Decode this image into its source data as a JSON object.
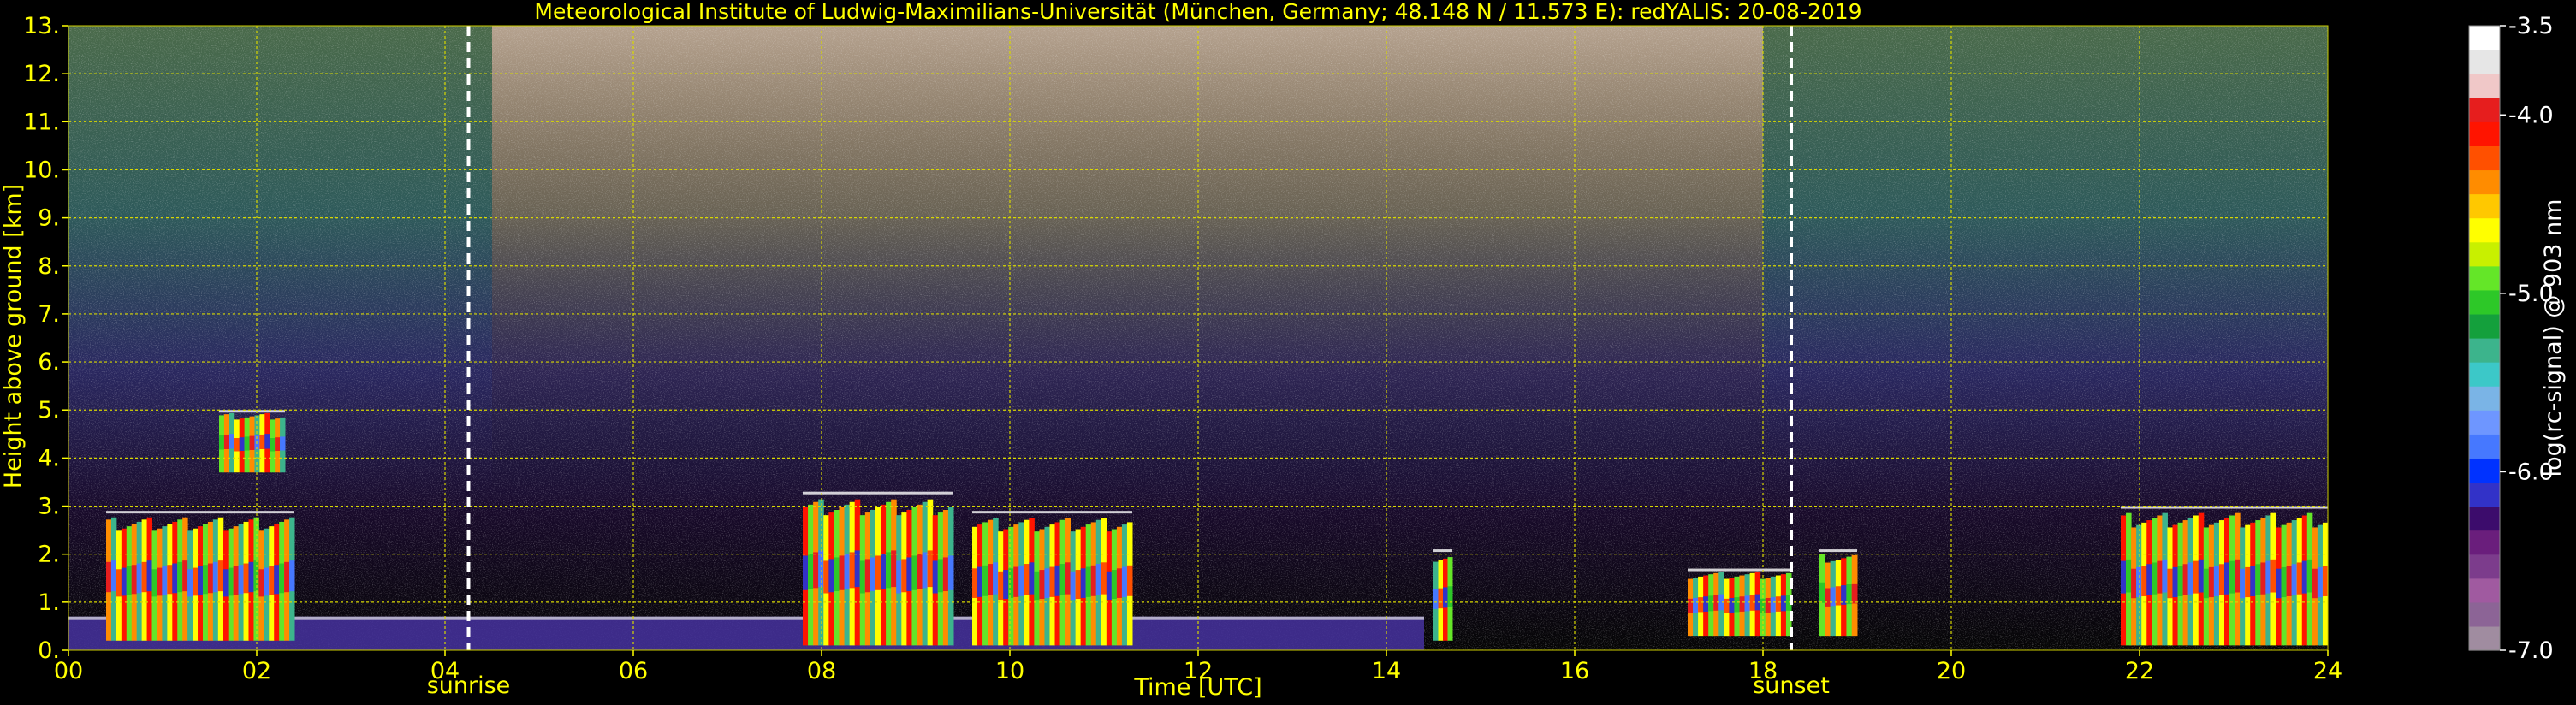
{
  "chart_data": {
    "type": "heatmap",
    "title": "Meteorological Institute of Ludwig-Maximilians-Universität (München, Germany; 48.148 N / 11.573 E):    redYALIS: 20-08-2019",
    "xlabel": "Time [UTC]",
    "ylabel": "Height above ground [km]",
    "xlim": [
      0,
      24
    ],
    "ylim": [
      0,
      13
    ],
    "x_ticks": [
      0,
      2,
      4,
      6,
      8,
      10,
      12,
      14,
      16,
      18,
      20,
      22,
      24
    ],
    "x_tick_labels": [
      "00",
      "02",
      "04",
      "06",
      "08",
      "10",
      "12",
      "14",
      "16",
      "18",
      "20",
      "22",
      "24"
    ],
    "y_ticks": [
      0,
      1,
      2,
      3,
      4,
      5,
      6,
      7,
      8,
      9,
      10,
      11,
      12,
      13
    ],
    "y_tick_labels": [
      "0.",
      "1.",
      "2.",
      "3.",
      "4.",
      "5.",
      "6.",
      "7.",
      "8.",
      "9.",
      "10.",
      "11.",
      "12.",
      "13."
    ],
    "grid": true,
    "grid_color": "#d8d800",
    "background": "#000000",
    "text_color": "#ffff00",
    "markers": [
      {
        "label": "sunrise",
        "time": 4.25
      },
      {
        "label": "sunset",
        "time": 18.3
      }
    ],
    "colorbar": {
      "label": "log(rc-signal) @ 903 nm",
      "range": [
        -7.0,
        -3.5
      ],
      "ticks": [
        -3.5,
        -4.0,
        -5.0,
        -6.0,
        -7.0
      ],
      "tick_labels": [
        "-3.5",
        "-4.0",
        "-5.0",
        "-6.0",
        "-7.0"
      ],
      "colors": [
        "#a08ca0",
        "#8c6496",
        "#a05aa0",
        "#7c3c8c",
        "#6a1e7c",
        "#3c0c6c",
        "#3232c8",
        "#0032ff",
        "#4678ff",
        "#6e96ff",
        "#7ab4e6",
        "#3cc8c8",
        "#3cb48c",
        "#14a03c",
        "#2dc828",
        "#64e628",
        "#c8f000",
        "#ffff00",
        "#ffc800",
        "#ff8c00",
        "#ff5000",
        "#ff1400",
        "#e61e1e",
        "#f0c8c8",
        "#e6e6e6",
        "#ffffff"
      ]
    },
    "features": [
      {
        "name": "boundary layer aerosol",
        "start": 0.0,
        "end": 14.4,
        "top_km": 0.7
      },
      {
        "name": "cloud",
        "start": 0.4,
        "end": 2.4,
        "base_km": 0.2,
        "top_km": 2.9
      },
      {
        "name": "elevated aerosol layer",
        "start": 1.6,
        "end": 2.3,
        "base_km": 3.7,
        "top_km": 5.0
      },
      {
        "name": "cloud",
        "start": 7.8,
        "end": 9.4,
        "base_km": 0.1,
        "top_km": 3.3
      },
      {
        "name": "cloud",
        "start": 9.6,
        "end": 11.3,
        "base_km": 0.1,
        "top_km": 2.9
      },
      {
        "name": "cloud",
        "start": 14.5,
        "end": 14.7,
        "base_km": 0.2,
        "top_km": 2.1
      },
      {
        "name": "cloud",
        "start": 17.2,
        "end": 18.3,
        "base_km": 0.3,
        "top_km": 1.7
      },
      {
        "name": "cloud",
        "start": 18.6,
        "end": 19.0,
        "base_km": 0.3,
        "top_km": 2.1
      },
      {
        "name": "cloud",
        "start": 21.8,
        "end": 24.0,
        "base_km": 0.1,
        "top_km": 3.0
      }
    ]
  }
}
